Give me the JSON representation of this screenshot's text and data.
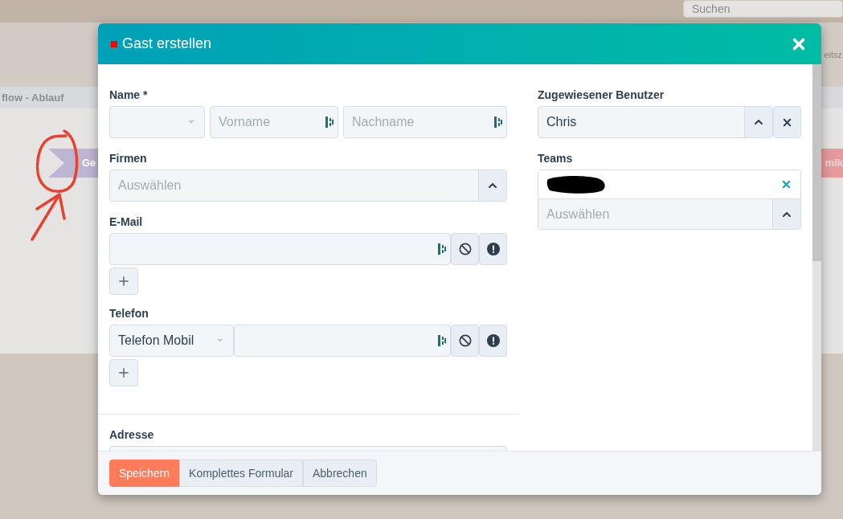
{
  "background": {
    "search": {
      "placeholder": "Suchen"
    },
    "header_fragment": "eitsz",
    "section_title": "flow - Ablauf",
    "stage_label": "Ge",
    "button_fragment": "mik"
  },
  "modal": {
    "title": "Gast erstellen",
    "name": {
      "label": "Name *",
      "first_name": {
        "placeholder": "Vorname"
      },
      "last_name": {
        "placeholder": "Nachname"
      }
    },
    "firms": {
      "label": "Firmen",
      "placeholder": "Auswählen"
    },
    "email": {
      "label": "E-Mail"
    },
    "phone": {
      "label": "Telefon",
      "type": "Telefon Mobil"
    },
    "address": {
      "label": "Adresse"
    },
    "assigned_user": {
      "label": "Zugewiesener Benutzer",
      "value": "Chris"
    },
    "teams": {
      "label": "Teams",
      "placeholder": "Auswählen"
    },
    "footer_buttons": [
      {
        "label": "Speichern",
        "kind": "primary"
      },
      {
        "label": "Komplettes Formular",
        "kind": "secondary"
      },
      {
        "label": "Abbrechen",
        "kind": "secondary"
      }
    ]
  }
}
